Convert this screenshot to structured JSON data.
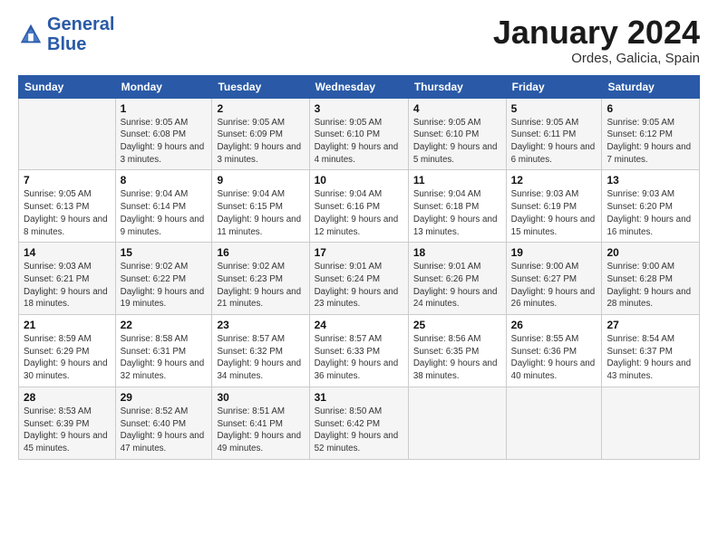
{
  "logo": {
    "line1": "General",
    "line2": "Blue"
  },
  "title": "January 2024",
  "location": "Ordes, Galicia, Spain",
  "days_header": [
    "Sunday",
    "Monday",
    "Tuesday",
    "Wednesday",
    "Thursday",
    "Friday",
    "Saturday"
  ],
  "weeks": [
    [
      {
        "day": "",
        "sunrise": "",
        "sunset": "",
        "daylight": ""
      },
      {
        "day": "1",
        "sunrise": "Sunrise: 9:05 AM",
        "sunset": "Sunset: 6:08 PM",
        "daylight": "Daylight: 9 hours and 3 minutes."
      },
      {
        "day": "2",
        "sunrise": "Sunrise: 9:05 AM",
        "sunset": "Sunset: 6:09 PM",
        "daylight": "Daylight: 9 hours and 3 minutes."
      },
      {
        "day": "3",
        "sunrise": "Sunrise: 9:05 AM",
        "sunset": "Sunset: 6:10 PM",
        "daylight": "Daylight: 9 hours and 4 minutes."
      },
      {
        "day": "4",
        "sunrise": "Sunrise: 9:05 AM",
        "sunset": "Sunset: 6:10 PM",
        "daylight": "Daylight: 9 hours and 5 minutes."
      },
      {
        "day": "5",
        "sunrise": "Sunrise: 9:05 AM",
        "sunset": "Sunset: 6:11 PM",
        "daylight": "Daylight: 9 hours and 6 minutes."
      },
      {
        "day": "6",
        "sunrise": "Sunrise: 9:05 AM",
        "sunset": "Sunset: 6:12 PM",
        "daylight": "Daylight: 9 hours and 7 minutes."
      }
    ],
    [
      {
        "day": "7",
        "sunrise": "Sunrise: 9:05 AM",
        "sunset": "Sunset: 6:13 PM",
        "daylight": "Daylight: 9 hours and 8 minutes."
      },
      {
        "day": "8",
        "sunrise": "Sunrise: 9:04 AM",
        "sunset": "Sunset: 6:14 PM",
        "daylight": "Daylight: 9 hours and 9 minutes."
      },
      {
        "day": "9",
        "sunrise": "Sunrise: 9:04 AM",
        "sunset": "Sunset: 6:15 PM",
        "daylight": "Daylight: 9 hours and 11 minutes."
      },
      {
        "day": "10",
        "sunrise": "Sunrise: 9:04 AM",
        "sunset": "Sunset: 6:16 PM",
        "daylight": "Daylight: 9 hours and 12 minutes."
      },
      {
        "day": "11",
        "sunrise": "Sunrise: 9:04 AM",
        "sunset": "Sunset: 6:18 PM",
        "daylight": "Daylight: 9 hours and 13 minutes."
      },
      {
        "day": "12",
        "sunrise": "Sunrise: 9:03 AM",
        "sunset": "Sunset: 6:19 PM",
        "daylight": "Daylight: 9 hours and 15 minutes."
      },
      {
        "day": "13",
        "sunrise": "Sunrise: 9:03 AM",
        "sunset": "Sunset: 6:20 PM",
        "daylight": "Daylight: 9 hours and 16 minutes."
      }
    ],
    [
      {
        "day": "14",
        "sunrise": "Sunrise: 9:03 AM",
        "sunset": "Sunset: 6:21 PM",
        "daylight": "Daylight: 9 hours and 18 minutes."
      },
      {
        "day": "15",
        "sunrise": "Sunrise: 9:02 AM",
        "sunset": "Sunset: 6:22 PM",
        "daylight": "Daylight: 9 hours and 19 minutes."
      },
      {
        "day": "16",
        "sunrise": "Sunrise: 9:02 AM",
        "sunset": "Sunset: 6:23 PM",
        "daylight": "Daylight: 9 hours and 21 minutes."
      },
      {
        "day": "17",
        "sunrise": "Sunrise: 9:01 AM",
        "sunset": "Sunset: 6:24 PM",
        "daylight": "Daylight: 9 hours and 23 minutes."
      },
      {
        "day": "18",
        "sunrise": "Sunrise: 9:01 AM",
        "sunset": "Sunset: 6:26 PM",
        "daylight": "Daylight: 9 hours and 24 minutes."
      },
      {
        "day": "19",
        "sunrise": "Sunrise: 9:00 AM",
        "sunset": "Sunset: 6:27 PM",
        "daylight": "Daylight: 9 hours and 26 minutes."
      },
      {
        "day": "20",
        "sunrise": "Sunrise: 9:00 AM",
        "sunset": "Sunset: 6:28 PM",
        "daylight": "Daylight: 9 hours and 28 minutes."
      }
    ],
    [
      {
        "day": "21",
        "sunrise": "Sunrise: 8:59 AM",
        "sunset": "Sunset: 6:29 PM",
        "daylight": "Daylight: 9 hours and 30 minutes."
      },
      {
        "day": "22",
        "sunrise": "Sunrise: 8:58 AM",
        "sunset": "Sunset: 6:31 PM",
        "daylight": "Daylight: 9 hours and 32 minutes."
      },
      {
        "day": "23",
        "sunrise": "Sunrise: 8:57 AM",
        "sunset": "Sunset: 6:32 PM",
        "daylight": "Daylight: 9 hours and 34 minutes."
      },
      {
        "day": "24",
        "sunrise": "Sunrise: 8:57 AM",
        "sunset": "Sunset: 6:33 PM",
        "daylight": "Daylight: 9 hours and 36 minutes."
      },
      {
        "day": "25",
        "sunrise": "Sunrise: 8:56 AM",
        "sunset": "Sunset: 6:35 PM",
        "daylight": "Daylight: 9 hours and 38 minutes."
      },
      {
        "day": "26",
        "sunrise": "Sunrise: 8:55 AM",
        "sunset": "Sunset: 6:36 PM",
        "daylight": "Daylight: 9 hours and 40 minutes."
      },
      {
        "day": "27",
        "sunrise": "Sunrise: 8:54 AM",
        "sunset": "Sunset: 6:37 PM",
        "daylight": "Daylight: 9 hours and 43 minutes."
      }
    ],
    [
      {
        "day": "28",
        "sunrise": "Sunrise: 8:53 AM",
        "sunset": "Sunset: 6:39 PM",
        "daylight": "Daylight: 9 hours and 45 minutes."
      },
      {
        "day": "29",
        "sunrise": "Sunrise: 8:52 AM",
        "sunset": "Sunset: 6:40 PM",
        "daylight": "Daylight: 9 hours and 47 minutes."
      },
      {
        "day": "30",
        "sunrise": "Sunrise: 8:51 AM",
        "sunset": "Sunset: 6:41 PM",
        "daylight": "Daylight: 9 hours and 49 minutes."
      },
      {
        "day": "31",
        "sunrise": "Sunrise: 8:50 AM",
        "sunset": "Sunset: 6:42 PM",
        "daylight": "Daylight: 9 hours and 52 minutes."
      },
      {
        "day": "",
        "sunrise": "",
        "sunset": "",
        "daylight": ""
      },
      {
        "day": "",
        "sunrise": "",
        "sunset": "",
        "daylight": ""
      },
      {
        "day": "",
        "sunrise": "",
        "sunset": "",
        "daylight": ""
      }
    ]
  ]
}
